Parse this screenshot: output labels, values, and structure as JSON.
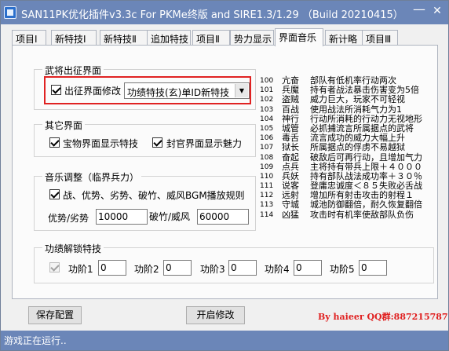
{
  "window": {
    "title": "SAN11PK优化插件v3.3c  For PKMe终版 and SIRE1.3/1.29 （Build 20210415）",
    "minimize_glyph": "—",
    "close_glyph": "✕"
  },
  "tabs": [
    {
      "label": "项目Ⅰ"
    },
    {
      "label": "新特技Ⅰ"
    },
    {
      "label": "新特技Ⅱ"
    },
    {
      "label": "追加特技"
    },
    {
      "label": "项目Ⅱ"
    },
    {
      "label": "势力显示"
    },
    {
      "label": "界面音乐"
    },
    {
      "label": "新计略"
    },
    {
      "label": "项目Ⅲ"
    }
  ],
  "active_tab": "界面音乐",
  "sortie_group": {
    "title": "武将出征界面",
    "checkbox_label": "出征界面修改",
    "checked": true,
    "select_value": "功绩特技(玄)单ID新特技"
  },
  "other_group": {
    "title": "其它界面",
    "treasure_label": "宝物界面显示特技",
    "treasure_checked": true,
    "title_label": "封官界面显示魅力",
    "title_checked": true
  },
  "music_group": {
    "title": "音乐调整（临界兵力）",
    "checkbox_label": "战、优势、劣势、破竹、威风BGM播放规则",
    "checked": true,
    "adv_label": "优势/劣势",
    "adv_value": "10000",
    "broken_label": "破竹/威风",
    "broken_value": "60000"
  },
  "merit_group": {
    "title": "功绩解锁特技",
    "checked": true,
    "levels": [
      {
        "label": "功阶1",
        "value": "0"
      },
      {
        "label": "功阶2",
        "value": "0"
      },
      {
        "label": "功阶3",
        "value": "0"
      },
      {
        "label": "功阶4",
        "value": "0"
      },
      {
        "label": "功阶5",
        "value": "0"
      }
    ]
  },
  "skill_list": [
    {
      "id": "100",
      "name": "亢奋",
      "desc": "部队有低机率行动两次"
    },
    {
      "id": "101",
      "name": "兵魔",
      "desc": "持有者战法暴击伤害变为5倍"
    },
    {
      "id": "102",
      "name": "盗贼",
      "desc": "威力巨大，玩家不可轻视"
    },
    {
      "id": "103",
      "name": "百战",
      "desc": "使用战法所消耗气力为1"
    },
    {
      "id": "104",
      "name": "神行",
      "desc": "行动所消耗的行动力无视地形"
    },
    {
      "id": "105",
      "name": "城管",
      "desc": "必抓捕流言所属据点的武将"
    },
    {
      "id": "106",
      "name": "毒舌",
      "desc": "流言成功的威力大幅上升"
    },
    {
      "id": "107",
      "name": "狱长",
      "desc": "所属据点的俘虏不易越狱"
    },
    {
      "id": "108",
      "name": "奋起",
      "desc": "破敌后可再行动，且增加气力"
    },
    {
      "id": "109",
      "name": "点兵",
      "desc": "主将持有带兵上限＋４０００"
    },
    {
      "id": "110",
      "name": "兵妖",
      "desc": "持有部队战法成功率＋３０％"
    },
    {
      "id": "111",
      "name": "说客",
      "desc": "登庸忠诚度＜８５失败必舌战"
    },
    {
      "id": "112",
      "name": "远射",
      "desc": "增加所有射击攻击的射程１"
    },
    {
      "id": "113",
      "name": "守城",
      "desc": "城池防御翻倍，耐久恢复翻倍"
    },
    {
      "id": "114",
      "name": "凶猛",
      "desc": "攻击时有机率使敌部队负伤"
    }
  ],
  "buttons": {
    "save": "保存配置",
    "start": "开启修改"
  },
  "author": "By haieer  QQ群:887215787",
  "status": "游戏正在运行.."
}
